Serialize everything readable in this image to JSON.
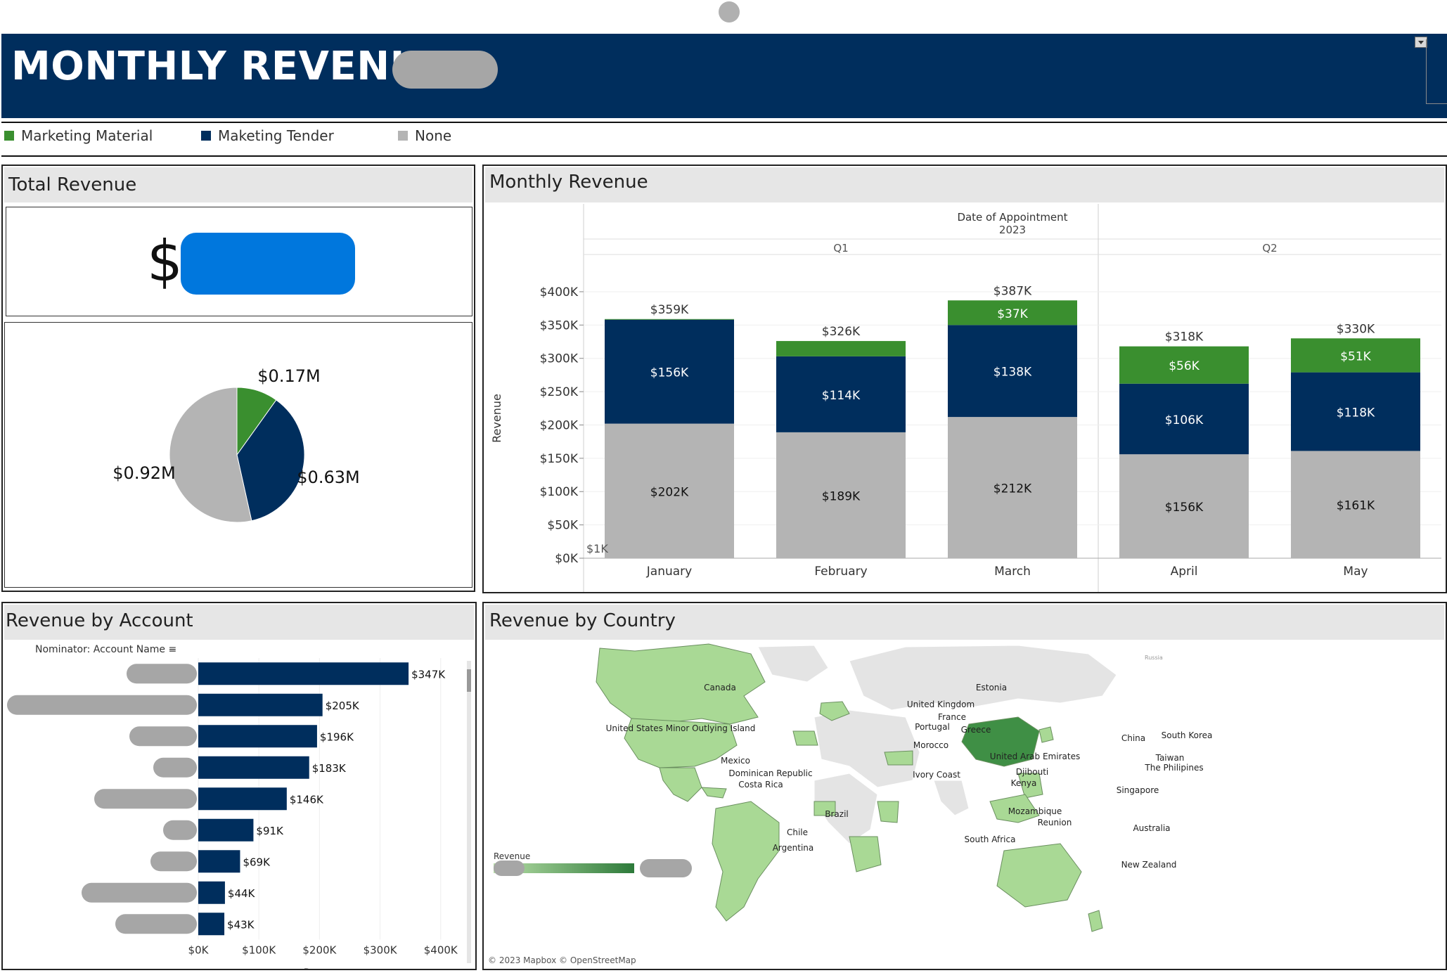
{
  "header": {
    "title": "MONTHLY REVENUE -"
  },
  "colors": {
    "marketing_material": "#3a8f2f",
    "marketing_tender": "#002e5d",
    "none": "#b4b4b4",
    "header_bg": "#002e5d"
  },
  "legend": [
    {
      "label": "Marketing Material",
      "color": "#3a8f2f"
    },
    {
      "label": "Maketing Tender",
      "color": "#002e5d"
    },
    {
      "label": "None",
      "color": "#b4b4b4"
    }
  ],
  "panels": {
    "total": {
      "title": "Total Revenue",
      "kpi_prefix": "$"
    },
    "monthly": {
      "title": "Monthly Revenue"
    },
    "account": {
      "title": "Revenue by Account"
    },
    "country": {
      "title": "Revenue by Country"
    }
  },
  "chart_data": [
    {
      "type": "pie",
      "slices": [
        {
          "label": "$0.17M",
          "value": 0.17,
          "series": "Marketing Material"
        },
        {
          "label": "$0.63M",
          "value": 0.63,
          "series": "Maketing Tender"
        },
        {
          "label": "$0.92M",
          "value": 0.92,
          "series": "None"
        }
      ]
    },
    {
      "type": "bar",
      "stacked": true,
      "header": "Date of Appointment",
      "year": "2023",
      "quarters": [
        {
          "label": "Q1",
          "months": 3
        },
        {
          "label": "Q2",
          "months": 2
        }
      ],
      "categories": [
        "January",
        "February",
        "March",
        "April",
        "May"
      ],
      "ylabel": "Revenue",
      "ylim": [
        0,
        420
      ],
      "yticks": [
        "$0K",
        "$50K",
        "$100K",
        "$150K",
        "$200K",
        "$250K",
        "$300K",
        "$350K",
        "$400K"
      ],
      "ytick_values": [
        0,
        50,
        100,
        150,
        200,
        250,
        300,
        350,
        400
      ],
      "totals": [
        "$359K",
        "$326K",
        "$387K",
        "$318K",
        "$330K"
      ],
      "total_values": [
        359,
        326,
        387,
        318,
        330
      ],
      "extra_label": "$1K",
      "series": [
        {
          "name": "None",
          "values": [
            202,
            189,
            212,
            156,
            161
          ],
          "labels": [
            "$202K",
            "$189K",
            "$212K",
            "$156K",
            "$161K"
          ]
        },
        {
          "name": "Maketing Tender",
          "values": [
            156,
            114,
            138,
            106,
            118
          ],
          "labels": [
            "$156K",
            "$114K",
            "$138K",
            "$106K",
            "$118K"
          ]
        },
        {
          "name": "Marketing Material",
          "values": [
            1,
            23,
            37,
            56,
            51
          ],
          "labels": [
            "",
            "",
            "$37K",
            "$56K",
            "$51K"
          ]
        }
      ]
    },
    {
      "type": "bar",
      "orientation": "horizontal",
      "header": "Nominator: Account Name",
      "xlabel": "Revenue",
      "xlim": [
        0,
        420
      ],
      "xticks": [
        "$0K",
        "$100K",
        "$200K",
        "$300K",
        "$400K"
      ],
      "xtick_values": [
        0,
        100,
        200,
        300,
        400
      ],
      "values": [
        347,
        205,
        196,
        183,
        146,
        91,
        69,
        44,
        43
      ],
      "labels": [
        "$347K",
        "$205K",
        "$196K",
        "$183K",
        "$146K",
        "$91K",
        "$69K",
        "$44K",
        "$43K"
      ]
    }
  ],
  "map": {
    "legend_title": "Revenue",
    "attribution": "© 2023 Mapbox © OpenStreetMap",
    "russia_label": "Russia",
    "countries": [
      "Canada",
      "United States Minor Outlying Island",
      "Mexico",
      "Dominican Republic",
      "Costa Rica",
      "Brazil",
      "Chile",
      "Argentina",
      "Estonia",
      "United Kingdom",
      "France",
      "Portugal",
      "Greece",
      "Morocco",
      "United Arab Emirates",
      "Ivory Coast",
      "Djibouti",
      "Kenya",
      "Mozambique",
      "Reunion",
      "South Africa",
      "China",
      "South Korea",
      "Taiwan",
      "The Philipines",
      "Singapore",
      "Australia",
      "New Zealand"
    ]
  }
}
